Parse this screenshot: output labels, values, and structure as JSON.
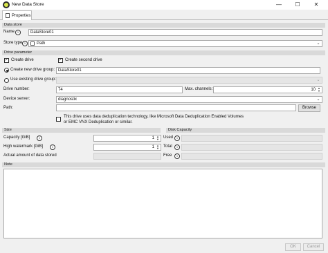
{
  "window": {
    "title": "New Data Store",
    "minimize": "—",
    "maximize": "☐",
    "close": "✕"
  },
  "tabs": [
    {
      "label": "Properties"
    }
  ],
  "data_store": {
    "header": "Data store",
    "name_label": "Name",
    "name_value": "DataStore01",
    "store_type_label": "Store type",
    "store_type_value": "Path"
  },
  "drive_parameter": {
    "header": "Drive parameter",
    "create_drive_label": "Create drive",
    "create_drive_checked": true,
    "create_second_drive_label": "Create second drive",
    "create_second_drive_checked": true,
    "create_new_group_label": "Create new drive group:",
    "create_new_group_value": "DataStore01",
    "use_existing_group_label": "Use existing drive group:",
    "drive_number_label": "Drive number:",
    "drive_number_value": "74",
    "max_channels_label": "Max. channels:",
    "max_channels_value": "10",
    "device_server_label": "Device server:",
    "device_server_value": "diagnostix",
    "path_label": "Path:",
    "path_value": "",
    "browse_label": "Browse",
    "dedup_line1": "This drive uses data deduplication technology, like Microsoft Data Deduplication Enabled Volumes",
    "dedup_line2": "or EMC VNX Deduplication or similar.",
    "dedup_checked": false
  },
  "size": {
    "header": "Size",
    "capacity_label": "Capacity [GiB]",
    "capacity_value": "1",
    "high_watermark_label": "High watermark [GiB]",
    "high_watermark_value": "1",
    "actual_amount_label": "Actual amount of data stored"
  },
  "disk_capacity": {
    "header": "Disk Capacity",
    "used_label": "Used",
    "total_label": "Total",
    "free_label": "Free"
  },
  "note": {
    "header": "Note",
    "value": ""
  },
  "footer": {
    "ok_label": "OK",
    "cancel_label": "Cancel"
  },
  "colors": {
    "section_header": "#d9d9d9",
    "app_icon": "#d8e64a",
    "window_bg": "#f0f0f0"
  },
  "icons": {
    "info": "info-icon",
    "path_type": "folder-path-icon"
  }
}
